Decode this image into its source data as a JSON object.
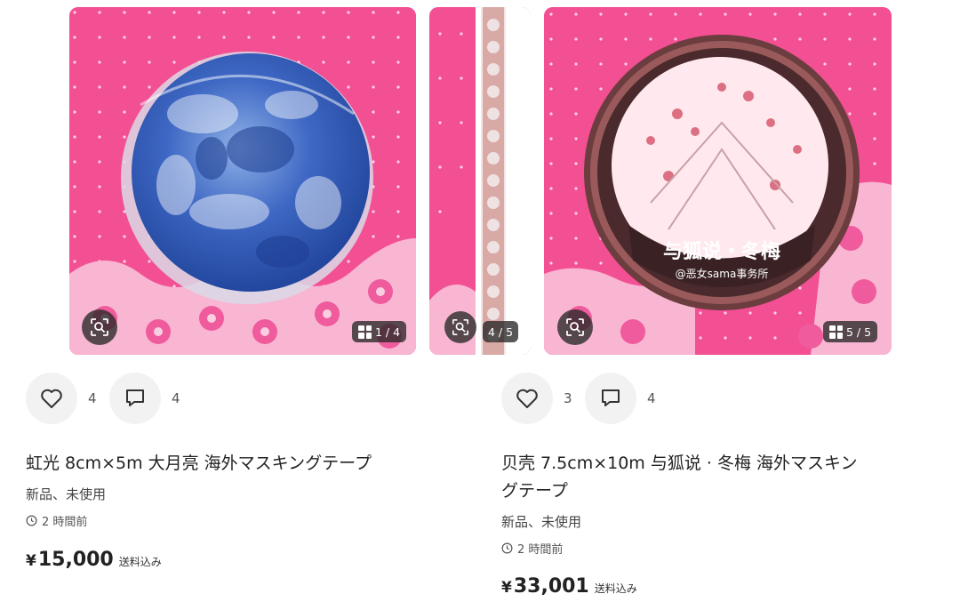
{
  "items": [
    {
      "image_counter": "1 / 4",
      "likes": "4",
      "comments": "4",
      "title": "虹光 8cm×5m 大月亮 海外マスキングテープ",
      "condition": "新品、未使用",
      "time": "2 時間前",
      "currency": "¥",
      "price": "15,000",
      "shipping": "送料込み"
    },
    {
      "image_counter": "4 / 5"
    },
    {
      "image_counter": "5 / 5",
      "likes": "3",
      "comments": "4",
      "title_line1": "贝壳 7.5cm×10m 与狐说 · 冬梅 海外マスキン",
      "title_line2": "グテープ",
      "tape_text_line1": "与狐说・冬梅",
      "tape_text_line2": "@恶女sama事务所",
      "condition": "新品、未使用",
      "time": "2 時間前",
      "currency": "¥",
      "price": "33,001",
      "shipping": "送料込み"
    }
  ],
  "colors": {
    "pink_bg": "#f34f93",
    "badge_bg": "#282828",
    "circle_bg": "#f2f2f2"
  },
  "icons": [
    "scan-icon",
    "grid-icon",
    "heart-icon",
    "comment-icon",
    "clock-icon"
  ]
}
